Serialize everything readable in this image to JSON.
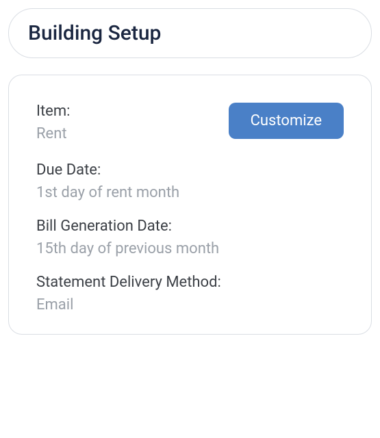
{
  "header": {
    "title": "Building Setup"
  },
  "actions": {
    "customize_label": "Customize"
  },
  "fields": {
    "item": {
      "label": "Item:",
      "value": "Rent"
    },
    "due_date": {
      "label": "Due Date:",
      "value": "1st day of rent month"
    },
    "bill_generation": {
      "label": "Bill Generation Date:",
      "value": "15th day of previous month"
    },
    "statement_delivery": {
      "label": "Statement Delivery Method:",
      "value": "Email"
    }
  }
}
